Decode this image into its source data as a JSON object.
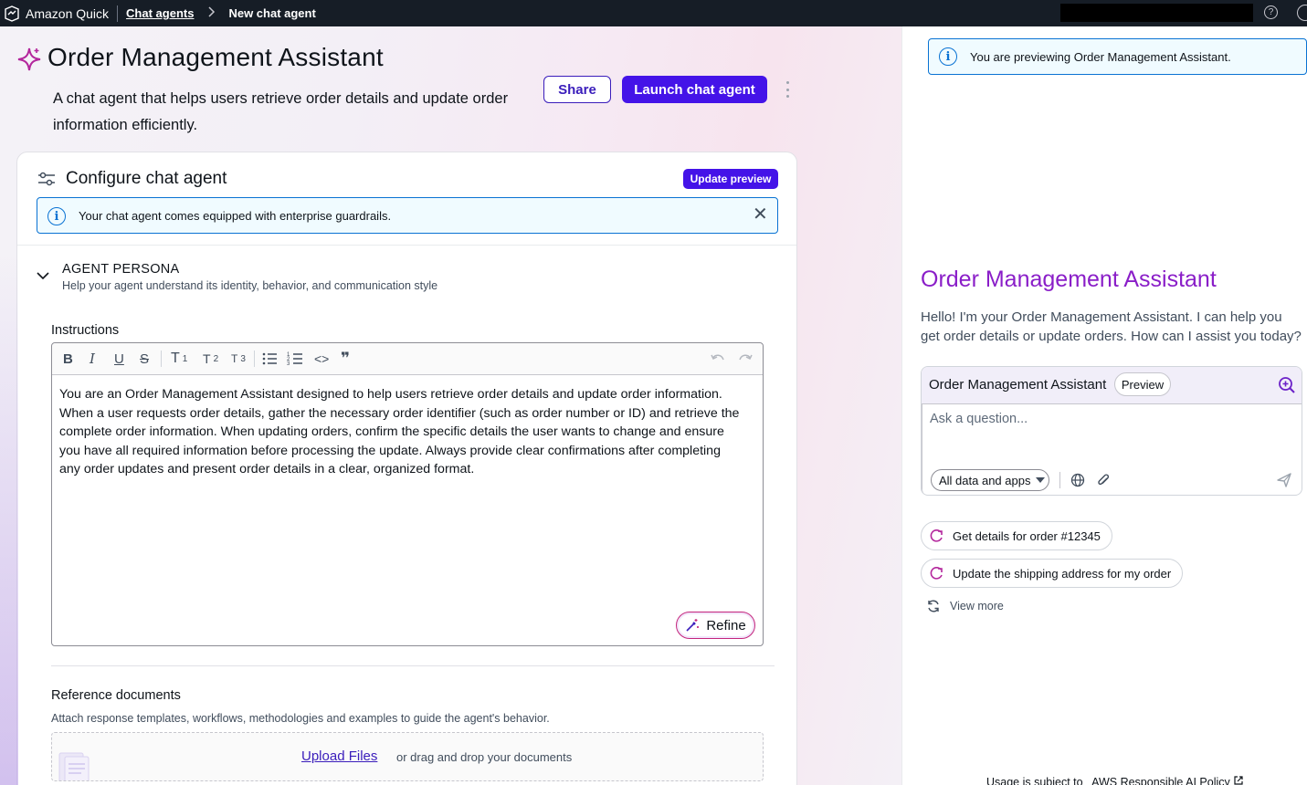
{
  "topbar": {
    "app_name": "Amazon Quick",
    "breadcrumb_link": "Chat agents",
    "breadcrumb_current": "New chat agent",
    "help_glyph": "?"
  },
  "header": {
    "title": "Order Management Assistant",
    "description": "A chat agent that helps users retrieve order details and update order information efficiently.",
    "share_label": "Share",
    "launch_label": "Launch chat agent"
  },
  "config": {
    "title": "Configure chat agent",
    "update_preview_label": "Update preview",
    "guardrail_alert": "Your chat agent comes equipped with enterprise guardrails.",
    "close_glyph": "✕",
    "persona": {
      "title": "AGENT PERSONA",
      "subtitle": "Help your agent understand its identity, behavior, and communication style"
    },
    "instructions": {
      "label": "Instructions",
      "toolbar": {
        "bold": "B",
        "italic": "I",
        "underline": "U",
        "strike": "S",
        "h1": "T",
        "h1_sub": "1",
        "h2": "T",
        "h2_sub": "2",
        "h3": "T",
        "h3_sub": "3",
        "code": "<>",
        "quote": "❞"
      },
      "text": "You are an Order Management Assistant designed to help users retrieve order details and update order information. When a user requests order details, gather the necessary order identifier (such as order number or ID) and retrieve the complete order information. When updating orders, confirm the specific details the user wants to change and ensure you have all required information before processing the update. Always provide clear confirmations after completing any order updates and present order details in a clear, organized format.",
      "refine_label": "Refine"
    },
    "reference": {
      "title": "Reference documents",
      "subtitle": "Attach response templates, workflows, methodologies and examples to guide the agent's behavior.",
      "upload_label": "Upload Files",
      "drag_text": "or drag and drop your documents"
    }
  },
  "preview": {
    "alert": "You are previewing Order Management Assistant.",
    "title": "Order Management Assistant",
    "greeting": "Hello! I'm your Order Management Assistant. I can help you get order details or update orders. How can I assist you today?",
    "chat": {
      "agent_name": "Order Management Assistant",
      "preview_badge": "Preview",
      "placeholder": "Ask a question...",
      "data_scope": "All data and apps"
    },
    "suggestions": [
      "Get details for order #12345",
      "Update the shipping address for my order"
    ],
    "view_more": "View more",
    "footer_prefix": "Usage is subject to",
    "footer_link": "AWS Responsible AI Policy"
  },
  "colors": {
    "primary": "#4413e8",
    "accent_purple": "#8a1ec8",
    "info_blue": "#0972d3",
    "refine_border": "#c4257c",
    "topbar_bg": "#161d26"
  }
}
